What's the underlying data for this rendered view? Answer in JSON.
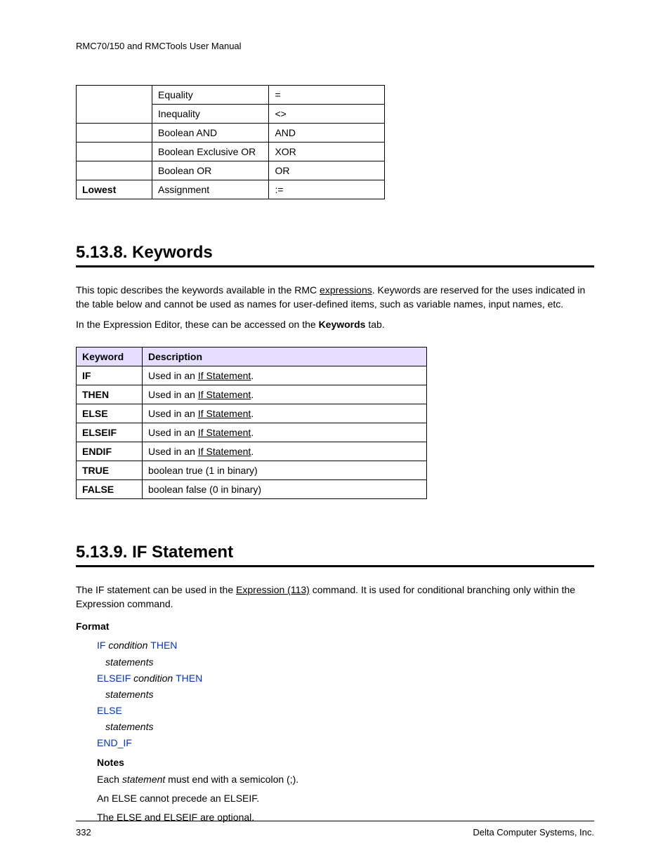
{
  "header": "RMC70/150 and RMCTools User Manual",
  "precedence_table": {
    "rows": [
      {
        "col1": "",
        "col2a": "Equality",
        "symA": "=",
        "col2b": "Inequality",
        "symB": "<>"
      },
      {
        "col1": "",
        "col2": "Boolean AND",
        "sym": "AND"
      },
      {
        "col1": "",
        "col2": "Boolean Exclusive OR",
        "sym": "XOR"
      },
      {
        "col1": "",
        "col2": "Boolean OR",
        "sym": "OR"
      },
      {
        "col1": "Lowest",
        "col2": "Assignment",
        "sym": ":="
      }
    ]
  },
  "section1": {
    "heading": "5.13.8. Keywords",
    "para1a": "This topic describes the keywords available in the RMC ",
    "para1link": "expressions",
    "para1b": ". Keywords are reserved for the uses indicated in the table below and cannot be used as names for user-defined items, such as variable names, input names, etc.",
    "para2a": "In the Expression Editor, these can be accessed on the ",
    "para2bold": "Keywords",
    "para2b": " tab."
  },
  "keywords_table": {
    "headers": {
      "k": "Keyword",
      "d": "Description"
    },
    "rows": [
      {
        "k": "IF",
        "pre": "Used in an ",
        "link": "If Statement",
        "post": "."
      },
      {
        "k": "THEN",
        "pre": "Used in an ",
        "link": "If Statement",
        "post": "."
      },
      {
        "k": "ELSE",
        "pre": "Used in an ",
        "link": "If Statement",
        "post": "."
      },
      {
        "k": "ELSEIF",
        "pre": "Used in an ",
        "link": "If Statement",
        "post": "."
      },
      {
        "k": "ENDIF",
        "pre": "Used in an ",
        "link": "If Statement",
        "post": "."
      },
      {
        "k": "TRUE",
        "desc": "boolean true (1 in binary)"
      },
      {
        "k": "FALSE",
        "desc": "boolean false (0 in binary)"
      }
    ]
  },
  "section2": {
    "heading": "5.13.9. IF Statement",
    "para1a": "The IF statement can be used in the ",
    "para1link": "Expression (113)",
    "para1b": " command. It is used for conditional branching only within the Expression command.",
    "format": "Format",
    "code": {
      "if": "IF",
      "cond": " condition ",
      "then": "THEN",
      "stmts": "statements",
      "elseif": "ELSEIF",
      "else": "ELSE",
      "endif": "END_IF"
    },
    "notes_label": "Notes",
    "note1a": "Each ",
    "note1i": "statement",
    "note1b": " must end with a semicolon (;).",
    "note2": "An ELSE cannot precede an ELSEIF.",
    "note3": "The ELSE and ELSEIF are optional."
  },
  "footer": {
    "page": "332",
    "company": "Delta Computer Systems, Inc."
  }
}
